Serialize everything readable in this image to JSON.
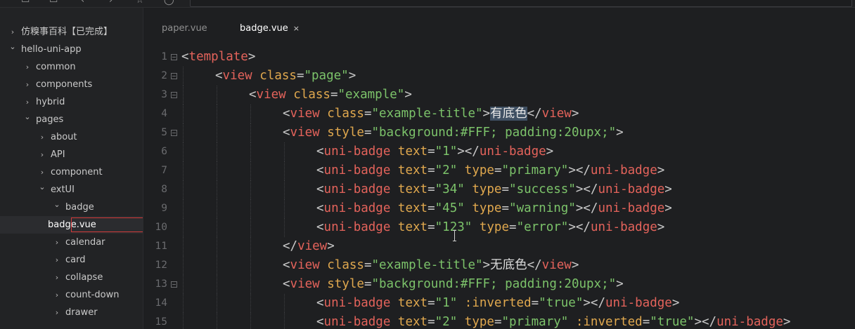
{
  "topbar": {
    "icons": [
      "save-icon",
      "folder-icon",
      "back-icon",
      "forward-icon",
      "star-icon",
      "info-icon"
    ]
  },
  "sidebar": {
    "items": [
      {
        "label": "仿糗事百科【已完成】",
        "depth": 0,
        "expanded": false
      },
      {
        "label": "hello-uni-app",
        "depth": 0,
        "expanded": true
      },
      {
        "label": "common",
        "depth": 1,
        "expanded": false
      },
      {
        "label": "components",
        "depth": 1,
        "expanded": false
      },
      {
        "label": "hybrid",
        "depth": 1,
        "expanded": false
      },
      {
        "label": "pages",
        "depth": 1,
        "expanded": true
      },
      {
        "label": "about",
        "depth": 2,
        "expanded": false
      },
      {
        "label": "API",
        "depth": 2,
        "expanded": false
      },
      {
        "label": "component",
        "depth": 2,
        "expanded": false
      },
      {
        "label": "extUI",
        "depth": 2,
        "expanded": true
      },
      {
        "label": "badge",
        "depth": 3,
        "expanded": true
      },
      {
        "label": "badge.vue",
        "depth": 4,
        "file": true,
        "selected": true
      },
      {
        "label": "calendar",
        "depth": 3,
        "expanded": false
      },
      {
        "label": "card",
        "depth": 3,
        "expanded": false
      },
      {
        "label": "collapse",
        "depth": 3,
        "expanded": false
      },
      {
        "label": "count-down",
        "depth": 3,
        "expanded": false
      },
      {
        "label": "drawer",
        "depth": 3,
        "expanded": false
      }
    ]
  },
  "tabs": [
    {
      "label": "paper.vue",
      "active": false
    },
    {
      "label": "badge.vue",
      "active": true,
      "close": "×"
    }
  ],
  "editor": {
    "lines": [
      {
        "n": "1",
        "fold": true,
        "indent": 0,
        "tokens": [
          [
            "pn",
            "<"
          ],
          [
            "tg",
            "template"
          ],
          [
            "pn",
            ">"
          ]
        ]
      },
      {
        "n": "2",
        "fold": true,
        "indent": 1,
        "tokens": [
          [
            "pn",
            "<"
          ],
          [
            "tg",
            "view"
          ],
          [
            "tx",
            " "
          ],
          [
            "at",
            "class"
          ],
          [
            "pn",
            "="
          ],
          [
            "st",
            "\"page\""
          ],
          [
            "pn",
            ">"
          ]
        ]
      },
      {
        "n": "3",
        "fold": true,
        "indent": 2,
        "tokens": [
          [
            "pn",
            "<"
          ],
          [
            "tg",
            "view"
          ],
          [
            "tx",
            " "
          ],
          [
            "at",
            "class"
          ],
          [
            "pn",
            "="
          ],
          [
            "st",
            "\"example\""
          ],
          [
            "pn",
            ">"
          ]
        ]
      },
      {
        "n": "4",
        "fold": false,
        "indent": 3,
        "tokens": [
          [
            "pn",
            "<"
          ],
          [
            "tg",
            "view"
          ],
          [
            "tx",
            " "
          ],
          [
            "at",
            "class"
          ],
          [
            "pn",
            "="
          ],
          [
            "st",
            "\"example-title\""
          ],
          [
            "pn",
            ">"
          ],
          [
            "hl",
            "有底色"
          ],
          [
            "pn",
            "</"
          ],
          [
            "tg",
            "view"
          ],
          [
            "pn",
            ">"
          ]
        ]
      },
      {
        "n": "5",
        "fold": true,
        "indent": 3,
        "tokens": [
          [
            "pn",
            "<"
          ],
          [
            "tg",
            "view"
          ],
          [
            "tx",
            " "
          ],
          [
            "at",
            "style"
          ],
          [
            "pn",
            "="
          ],
          [
            "st",
            "\"background:#FFF; padding:20upx;\""
          ],
          [
            "pn",
            ">"
          ]
        ]
      },
      {
        "n": "6",
        "fold": false,
        "indent": 4,
        "tokens": [
          [
            "pn",
            "<"
          ],
          [
            "tg",
            "uni-badge"
          ],
          [
            "tx",
            " "
          ],
          [
            "at",
            "text"
          ],
          [
            "pn",
            "="
          ],
          [
            "st",
            "\"1\""
          ],
          [
            "pn",
            "></"
          ],
          [
            "tg",
            "uni-badge"
          ],
          [
            "pn",
            ">"
          ]
        ]
      },
      {
        "n": "7",
        "fold": false,
        "indent": 4,
        "tokens": [
          [
            "pn",
            "<"
          ],
          [
            "tg",
            "uni-badge"
          ],
          [
            "tx",
            " "
          ],
          [
            "at",
            "text"
          ],
          [
            "pn",
            "="
          ],
          [
            "st",
            "\"2\""
          ],
          [
            "tx",
            " "
          ],
          [
            "at",
            "type"
          ],
          [
            "pn",
            "="
          ],
          [
            "st",
            "\"primary\""
          ],
          [
            "pn",
            "></"
          ],
          [
            "tg",
            "uni-badge"
          ],
          [
            "pn",
            ">"
          ]
        ]
      },
      {
        "n": "8",
        "fold": false,
        "indent": 4,
        "tokens": [
          [
            "pn",
            "<"
          ],
          [
            "tg",
            "uni-badge"
          ],
          [
            "tx",
            " "
          ],
          [
            "at",
            "text"
          ],
          [
            "pn",
            "="
          ],
          [
            "st",
            "\"34\""
          ],
          [
            "tx",
            " "
          ],
          [
            "at",
            "type"
          ],
          [
            "pn",
            "="
          ],
          [
            "st",
            "\"success\""
          ],
          [
            "pn",
            "></"
          ],
          [
            "tg",
            "uni-badge"
          ],
          [
            "pn",
            ">"
          ]
        ]
      },
      {
        "n": "9",
        "fold": false,
        "indent": 4,
        "tokens": [
          [
            "pn",
            "<"
          ],
          [
            "tg",
            "uni-badge"
          ],
          [
            "tx",
            " "
          ],
          [
            "at",
            "text"
          ],
          [
            "pn",
            "="
          ],
          [
            "st",
            "\"45\""
          ],
          [
            "tx",
            " "
          ],
          [
            "at",
            "type"
          ],
          [
            "pn",
            "="
          ],
          [
            "st",
            "\"warning\""
          ],
          [
            "pn",
            "></"
          ],
          [
            "tg",
            "uni-badge"
          ],
          [
            "pn",
            ">"
          ]
        ]
      },
      {
        "n": "10",
        "fold": false,
        "indent": 4,
        "tokens": [
          [
            "pn",
            "<"
          ],
          [
            "tg",
            "uni-badge"
          ],
          [
            "tx",
            " "
          ],
          [
            "at",
            "text"
          ],
          [
            "pn",
            "="
          ],
          [
            "st",
            "\"123\""
          ],
          [
            "tx",
            " "
          ],
          [
            "at",
            "type"
          ],
          [
            "pn",
            "="
          ],
          [
            "st",
            "\"error\""
          ],
          [
            "pn",
            "></"
          ],
          [
            "tg",
            "uni-badge"
          ],
          [
            "pn",
            ">"
          ]
        ]
      },
      {
        "n": "11",
        "fold": false,
        "indent": 3,
        "tokens": [
          [
            "pn",
            "</"
          ],
          [
            "tg",
            "view"
          ],
          [
            "pn",
            ">"
          ]
        ]
      },
      {
        "n": "12",
        "fold": false,
        "indent": 3,
        "tokens": [
          [
            "pn",
            "<"
          ],
          [
            "tg",
            "view"
          ],
          [
            "tx",
            " "
          ],
          [
            "at",
            "class"
          ],
          [
            "pn",
            "="
          ],
          [
            "st",
            "\"example-title\""
          ],
          [
            "pn",
            ">"
          ],
          [
            "tx",
            "无底色"
          ],
          [
            "pn",
            "</"
          ],
          [
            "tg",
            "view"
          ],
          [
            "pn",
            ">"
          ]
        ]
      },
      {
        "n": "13",
        "fold": true,
        "indent": 3,
        "tokens": [
          [
            "pn",
            "<"
          ],
          [
            "tg",
            "view"
          ],
          [
            "tx",
            " "
          ],
          [
            "at",
            "style"
          ],
          [
            "pn",
            "="
          ],
          [
            "st",
            "\"background:#FFF; padding:20upx;\""
          ],
          [
            "pn",
            ">"
          ]
        ]
      },
      {
        "n": "14",
        "fold": false,
        "indent": 4,
        "tokens": [
          [
            "pn",
            "<"
          ],
          [
            "tg",
            "uni-badge"
          ],
          [
            "tx",
            " "
          ],
          [
            "at",
            "text"
          ],
          [
            "pn",
            "="
          ],
          [
            "st",
            "\"1\""
          ],
          [
            "tx",
            " "
          ],
          [
            "at",
            ":inverted"
          ],
          [
            "pn",
            "="
          ],
          [
            "st",
            "\"true\""
          ],
          [
            "pn",
            "></"
          ],
          [
            "tg",
            "uni-badge"
          ],
          [
            "pn",
            ">"
          ]
        ]
      },
      {
        "n": "15",
        "fold": false,
        "indent": 4,
        "tokens": [
          [
            "pn",
            "<"
          ],
          [
            "tg",
            "uni-badge"
          ],
          [
            "tx",
            " "
          ],
          [
            "at",
            "text"
          ],
          [
            "pn",
            "="
          ],
          [
            "st",
            "\"2\""
          ],
          [
            "tx",
            " "
          ],
          [
            "at",
            "type"
          ],
          [
            "pn",
            "="
          ],
          [
            "st",
            "\"primary\""
          ],
          [
            "tx",
            " "
          ],
          [
            "at",
            ":inverted"
          ],
          [
            "pn",
            "="
          ],
          [
            "st",
            "\"true\""
          ],
          [
            "pn",
            "></"
          ],
          [
            "tg",
            "uni-badge"
          ],
          [
            "pn",
            ">"
          ]
        ]
      }
    ]
  }
}
